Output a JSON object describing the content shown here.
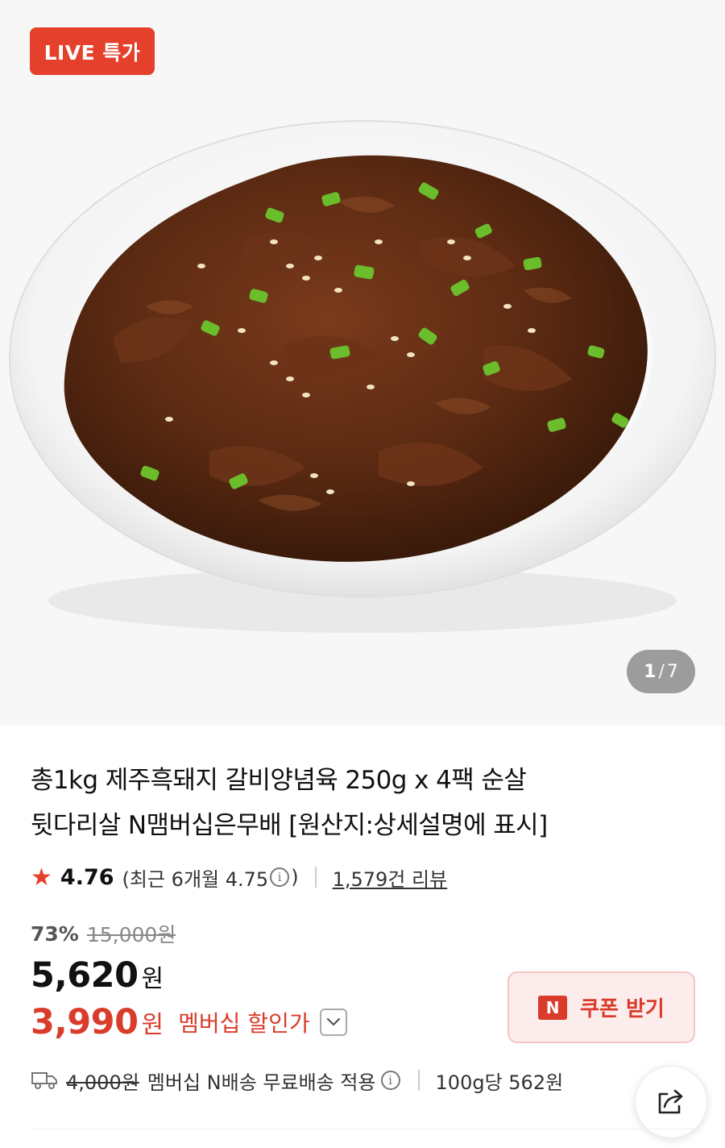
{
  "hero": {
    "badge": "LIVE 특가",
    "counter_current": "1",
    "counter_separator": "/",
    "counter_total": "7"
  },
  "product": {
    "title_line1": "총1kg 제주흑돼지 갈비양념육 250g x 4팩 순살",
    "title_line2": "뒷다리살 N맴버십은무배 [원산지:상세설명에 표시]"
  },
  "rating": {
    "star": "★",
    "score": "4.76",
    "recent_prefix": "(최근 6개월 4.75",
    "info_glyph": "i",
    "recent_suffix": ")",
    "reviews": "1,579건 리뷰"
  },
  "pricing": {
    "discount_pct": "73%",
    "original_price": "15,000원",
    "price": "5,620",
    "price_unit": "원",
    "member_price": "3,990",
    "member_unit": "원",
    "member_label": "멤버십 할인가"
  },
  "coupon": {
    "badge": "N",
    "label": "쿠폰 받기"
  },
  "delivery": {
    "original_fee": "4,000원",
    "text": "멤버십 N배송 무료배송 적용",
    "info_glyph": "i",
    "unit_price": "100g당 562원"
  },
  "colors": {
    "accent": "#e4402b",
    "member_red": "#d93c2b",
    "coupon_bg": "#fdecec"
  },
  "icons": {
    "rating": "star-icon",
    "delivery": "truck-icon",
    "share": "share-icon",
    "expand": "chevron-down-icon"
  }
}
